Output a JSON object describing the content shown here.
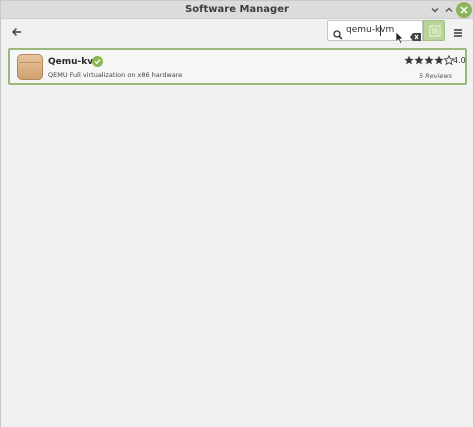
{
  "window": {
    "title": "Software Manager"
  },
  "search": {
    "query": "qemu-kvm"
  },
  "results": [
    {
      "name": "Qemu-kvm",
      "summary": "QEMU Full virtualization on x86 hardware",
      "rating_value": 4,
      "rating_text": "4.0",
      "reviews": "5 Reviews"
    }
  ],
  "icons": {
    "back": "arrow-left-icon",
    "search": "magnifier-icon",
    "clear": "backspace-clear-icon",
    "filter": "list-filter-icon",
    "menu": "hamburger-menu-icon",
    "verified": "check-circle-icon"
  },
  "colors": {
    "accent": "#8fb358",
    "selection_border": "#9ab87a",
    "filter_button": "#b9d49b"
  }
}
